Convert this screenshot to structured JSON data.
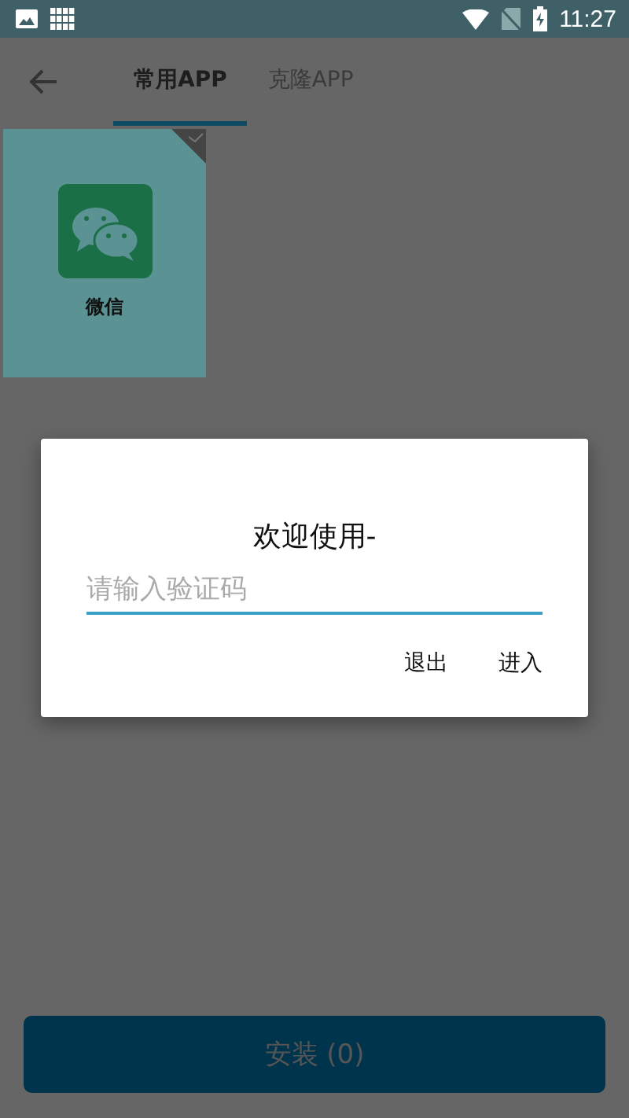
{
  "status_bar": {
    "time": "11:27"
  },
  "tabs": [
    {
      "label": "常用APP",
      "selected": true
    },
    {
      "label": "克隆APP",
      "selected": false
    }
  ],
  "apps": [
    {
      "name": "微信",
      "selected": true
    }
  ],
  "dialog": {
    "title": "欢迎使用-",
    "input": {
      "placeholder": "请输入验证码"
    },
    "buttons": [
      "退出",
      "进入"
    ]
  },
  "install_button": {
    "label": "安装 (0)"
  }
}
